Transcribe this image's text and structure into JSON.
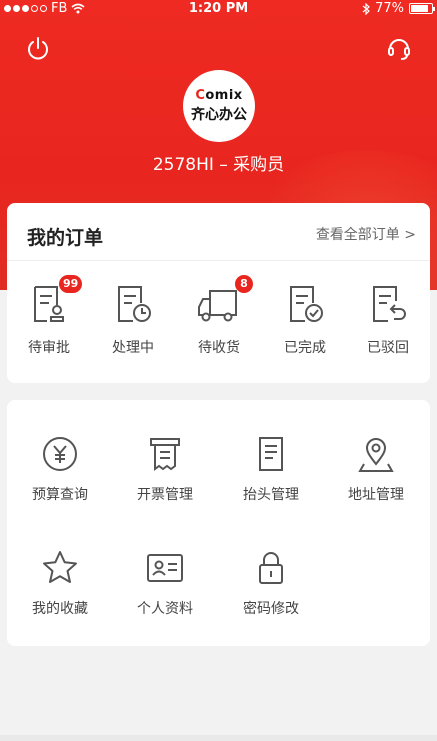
{
  "status_bar": {
    "carrier": "FB",
    "time": "1:20 PM",
    "battery": "77%",
    "battery_level": 0.77
  },
  "header": {
    "logo_en": "omix",
    "logo_c": "C",
    "logo_cn": "齐心办公",
    "user_line": "2578HI – 采购员"
  },
  "orders": {
    "title": "我的订单",
    "view_all": "查看全部订单 >",
    "items": [
      {
        "label": "待审批",
        "badge": "99",
        "icon": "approval-icon"
      },
      {
        "label": "处理中",
        "badge": "",
        "icon": "processing-icon"
      },
      {
        "label": "待收货",
        "badge": "8",
        "icon": "delivery-truck-icon"
      },
      {
        "label": "已完成",
        "badge": "",
        "icon": "completed-icon"
      },
      {
        "label": "已驳回",
        "badge": "",
        "icon": "rejected-icon"
      }
    ]
  },
  "services": {
    "items": [
      {
        "label": "预算查询",
        "icon": "budget-yen-icon"
      },
      {
        "label": "开票管理",
        "icon": "invoice-icon"
      },
      {
        "label": "抬头管理",
        "icon": "title-document-icon"
      },
      {
        "label": "地址管理",
        "icon": "location-pin-icon"
      },
      {
        "label": "我的收藏",
        "icon": "star-icon"
      },
      {
        "label": "个人资料",
        "icon": "profile-card-icon"
      },
      {
        "label": "密码修改",
        "icon": "lock-icon"
      }
    ]
  },
  "colors": {
    "brand_red": "#e8261f",
    "icon_gray": "#555555"
  }
}
